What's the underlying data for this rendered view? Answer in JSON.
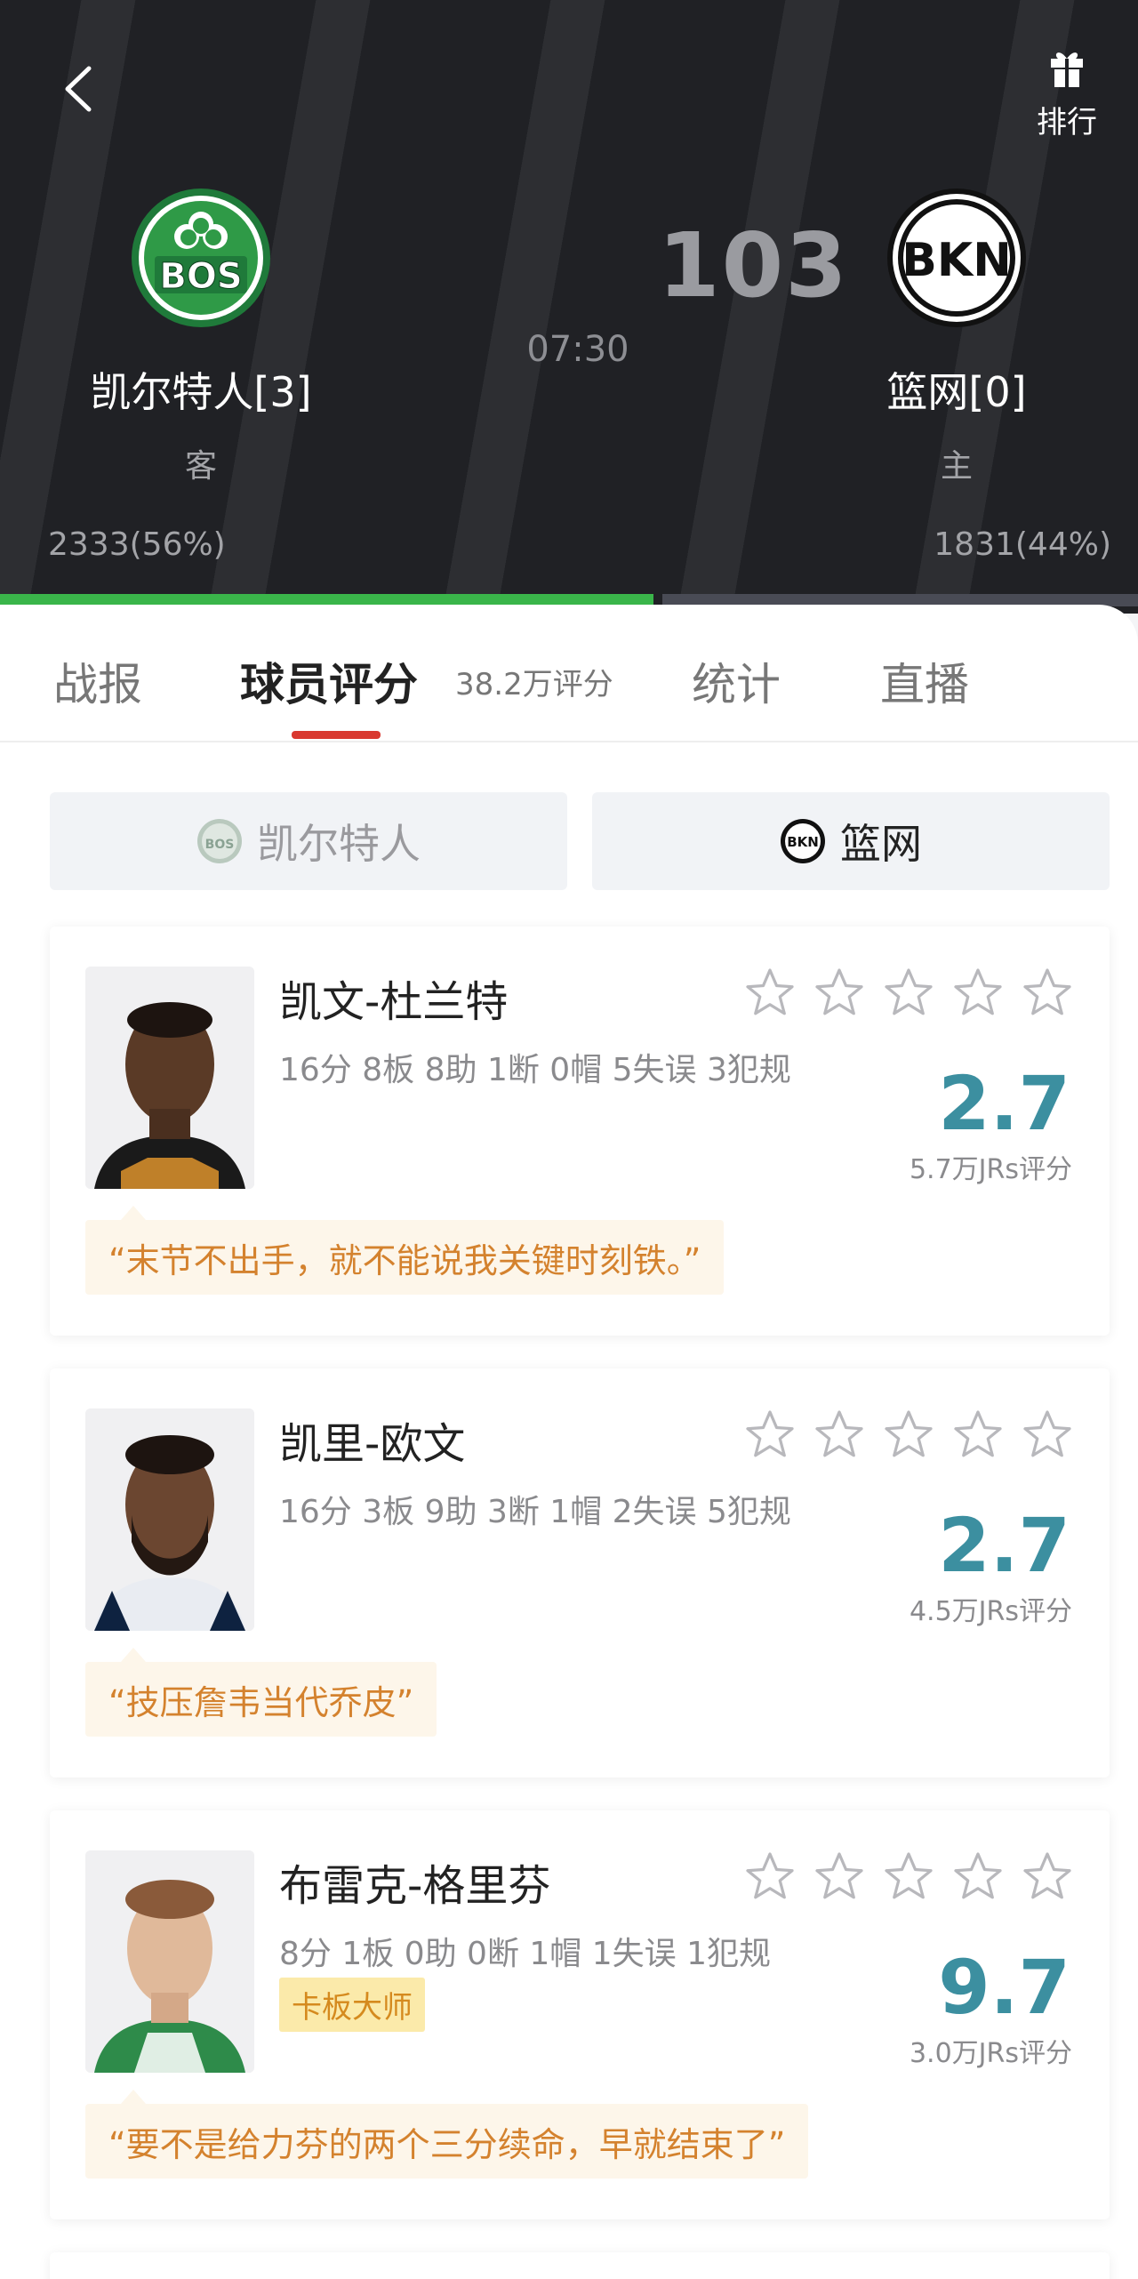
{
  "header": {
    "rank_label": "排行",
    "away_team": {
      "name": "凯尔特人[3]",
      "side": "客",
      "logo_text": "BOS",
      "votes": "2333(56%)",
      "vote_share": 0.56
    },
    "home_team": {
      "name": "篮网[0]",
      "side": "主",
      "logo_text": "BKN",
      "votes": "1831(44%)",
      "vote_share": 0.44
    },
    "score": "103",
    "game_time": "07:30"
  },
  "tabs": [
    {
      "label": "战报",
      "active": false
    },
    {
      "label": "球员评分",
      "active": true,
      "sub": "38.2万评分"
    },
    {
      "label": "统计",
      "active": false
    },
    {
      "label": "直播",
      "active": false
    }
  ],
  "team_toggle": {
    "left": {
      "label": "凯尔特人",
      "icon": "BOS"
    },
    "right": {
      "label": "篮网",
      "icon": "BKN"
    }
  },
  "players": [
    {
      "name": "凯文-杜兰特",
      "stats": "16分 8板 8助 1断 0帽 5失误 3犯规",
      "score": "2.7",
      "ratings": "5.7万JRs评分",
      "quote": "“末节不出手，就不能说我关键时刻铁。”",
      "tag": ""
    },
    {
      "name": "凯里-欧文",
      "stats": "16分 3板 9助 3断 1帽 2失误 5犯规",
      "score": "2.7",
      "ratings": "4.5万JRs评分",
      "quote": "“技压詹韦当代乔皮”",
      "tag": ""
    },
    {
      "name": "布雷克-格里芬",
      "stats": "8分 1板 0助 0断 1帽 1失误 1犯规",
      "score": "9.7",
      "ratings": "3.0万JRs评分",
      "quote": "“要不是给力芬的两个三分续命，早就结束了”",
      "tag": "卡板大师"
    }
  ],
  "colors": {
    "accent": "#d9382f",
    "score_teal": "#3c8fa0",
    "quote_orange": "#d4822e",
    "celtics_green": "#3ab54a"
  }
}
